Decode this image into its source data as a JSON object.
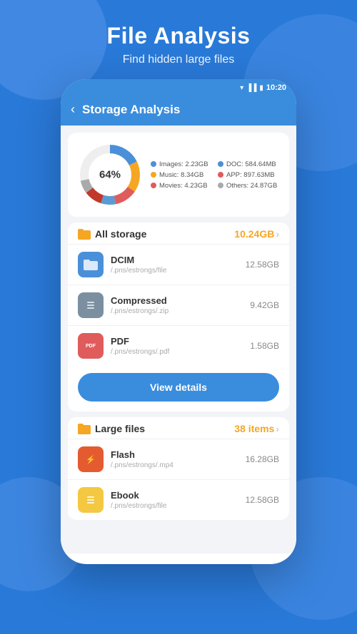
{
  "background_color": "#2979d8",
  "header": {
    "title": "File Analysis",
    "subtitle": "Find hidden large files"
  },
  "phone": {
    "status_bar": {
      "time": "10:20"
    },
    "topbar": {
      "title": "Storage Analysis",
      "back_label": "<"
    },
    "storage_chart": {
      "percentage": "64%",
      "legend": [
        {
          "label": "Images:",
          "value": "2.23GB",
          "color": "#4a90d9"
        },
        {
          "label": "DOC:",
          "value": "584.64MB",
          "color": "#4a90d9"
        },
        {
          "label": "Music:",
          "value": "8.34GB",
          "color": "#f5a623"
        },
        {
          "label": "APP:",
          "value": "897.63MB",
          "color": "#e05c5c"
        },
        {
          "label": "Movies:",
          "value": "4.23GB",
          "color": "#e05c5c"
        },
        {
          "label": "Others:",
          "value": "24.87GB",
          "color": "#aaa"
        }
      ],
      "donut_colors": [
        "#4a90d9",
        "#f5a623",
        "#e05c5c",
        "#aaa",
        "#5cb85c"
      ]
    },
    "all_storage": {
      "title": "All storage",
      "value": "10.24GB",
      "files": [
        {
          "name": "DCIM",
          "path": "/.pns/estrongs/file",
          "size": "12.58GB",
          "icon": "folder"
        },
        {
          "name": "Compressed",
          "path": "/.pns/estrongs/.zip",
          "size": "9.42GB",
          "icon": "zip"
        },
        {
          "name": "PDF",
          "path": "/.pns/estrongs/.pdf",
          "size": "1.58GB",
          "icon": "pdf"
        }
      ],
      "view_details_label": "View details"
    },
    "large_files": {
      "title": "Large files",
      "badge": "38 items",
      "files": [
        {
          "name": "Flash",
          "path": "/.pns/estrongs/.mp4",
          "size": "16.28GB",
          "icon": "flash"
        },
        {
          "name": "Ebook",
          "path": "/.pns/estrongs/file",
          "size": "12.58GB",
          "icon": "ebook"
        }
      ]
    }
  }
}
